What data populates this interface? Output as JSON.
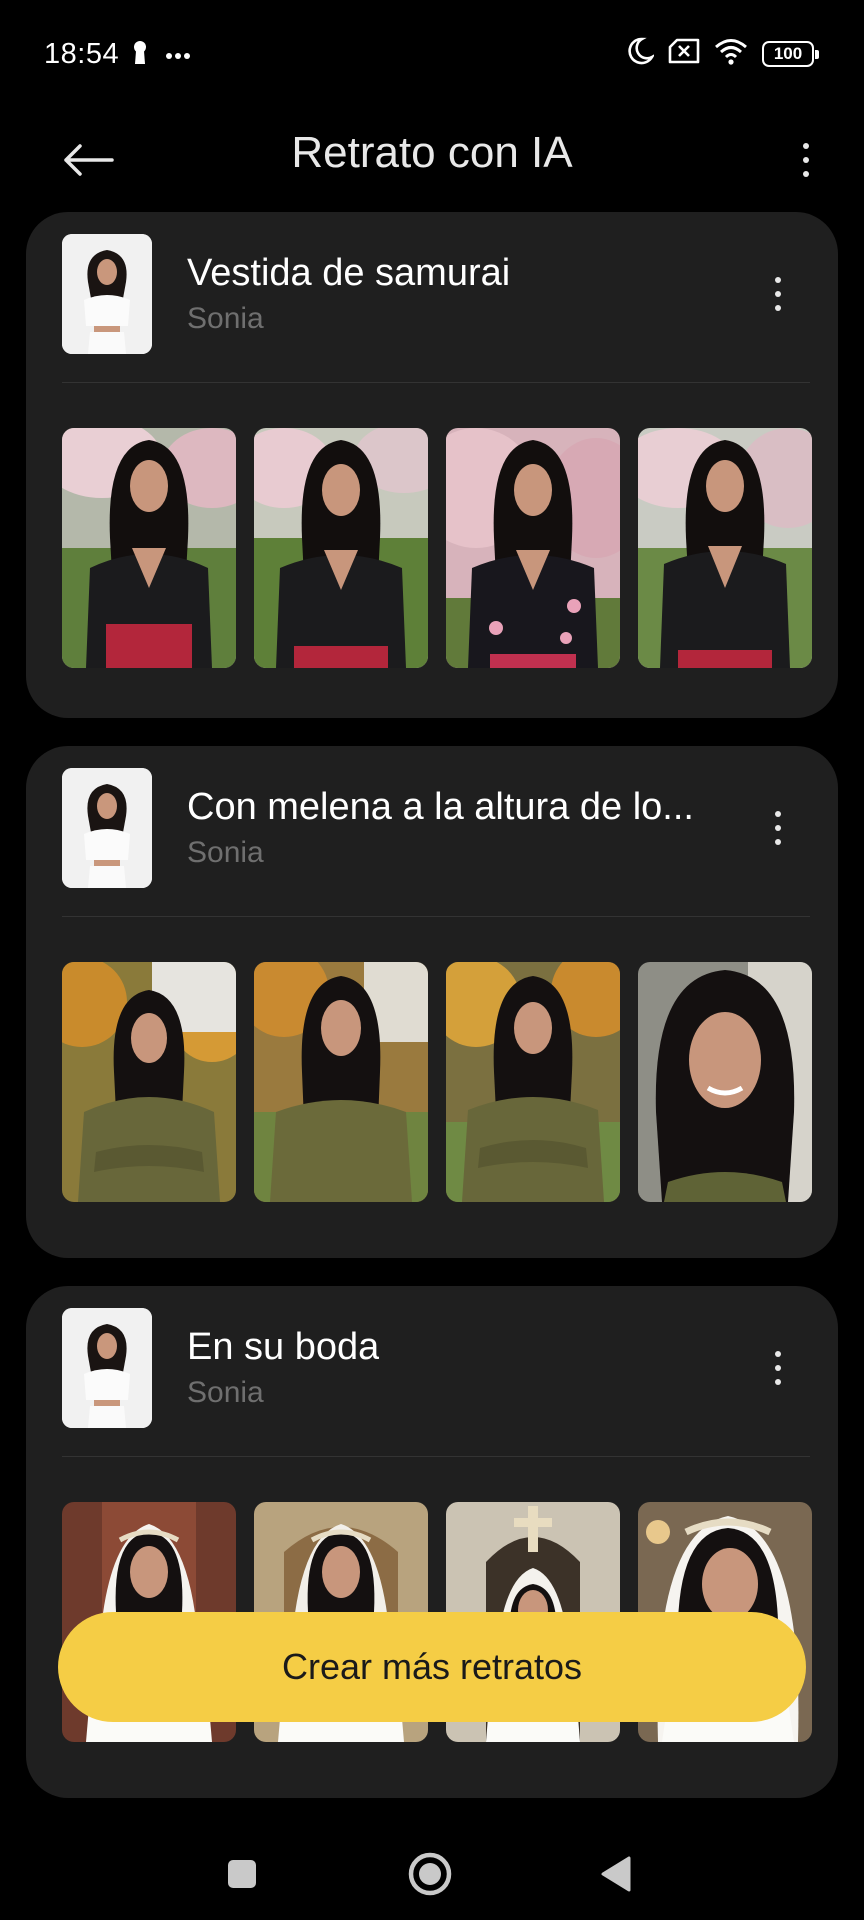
{
  "status_bar": {
    "time": "18:54",
    "battery": "100",
    "icons": [
      "keyhole-icon",
      "more-dots-icon",
      "moon-icon",
      "sim-off-icon",
      "wifi-icon",
      "battery-icon"
    ]
  },
  "app_bar": {
    "title": "Retrato con IA",
    "back_icon": "arrow-left-icon",
    "menu_icon": "more-vertical-icon"
  },
  "albums": [
    {
      "title": "Vestida de samurai",
      "subtitle": "Sonia",
      "theme": "samurai",
      "photo_count": 4
    },
    {
      "title": "Con melena a la altura de lo...",
      "subtitle": "Sonia",
      "theme": "autumn",
      "photo_count": 4
    },
    {
      "title": "En su boda",
      "subtitle": "Sonia",
      "theme": "wedding",
      "photo_count": 4
    }
  ],
  "cta": {
    "label": "Crear más retratos"
  },
  "nav_bar": {
    "icons": [
      "square-recents-icon",
      "circle-home-icon",
      "triangle-back-icon"
    ]
  },
  "colors": {
    "background": "#000000",
    "card": "#1f1f1f",
    "accent": "#f5cd45",
    "subtitle": "#6f6f6f"
  }
}
